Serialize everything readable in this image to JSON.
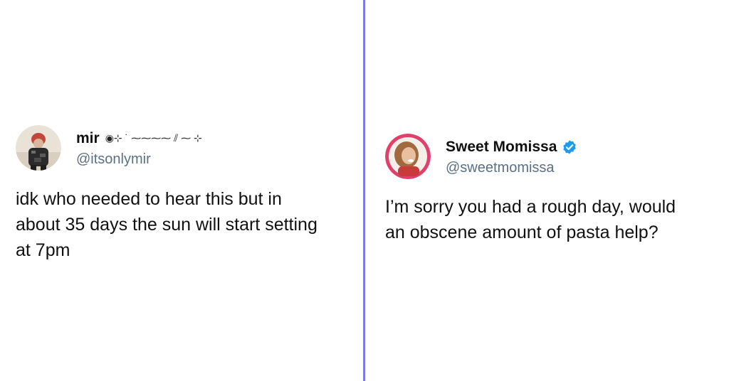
{
  "tweets": [
    {
      "display_name": "mir",
      "name_decoration": "◉⊹ ˙ ⁓⁓⁓⁓ ⫽ ⁓ ⊹",
      "handle": "@itsonlymir",
      "verified": false,
      "text": "idk who needed to hear this but in\nabout 35 days the sun will start setting\nat 7pm",
      "avatar_icon": "person-avatar-dark"
    },
    {
      "display_name": "Sweet Momissa",
      "handle": "@sweetmomissa",
      "verified": true,
      "text": "I’m sorry you had a rough day, would\nan obscene amount of pasta help?",
      "avatar_icon": "person-avatar-smiling"
    }
  ],
  "colors": {
    "divider": "#7b78e8",
    "verified_badge": "#1d9bf0",
    "handle": "#5b7083",
    "text": "#111111"
  }
}
